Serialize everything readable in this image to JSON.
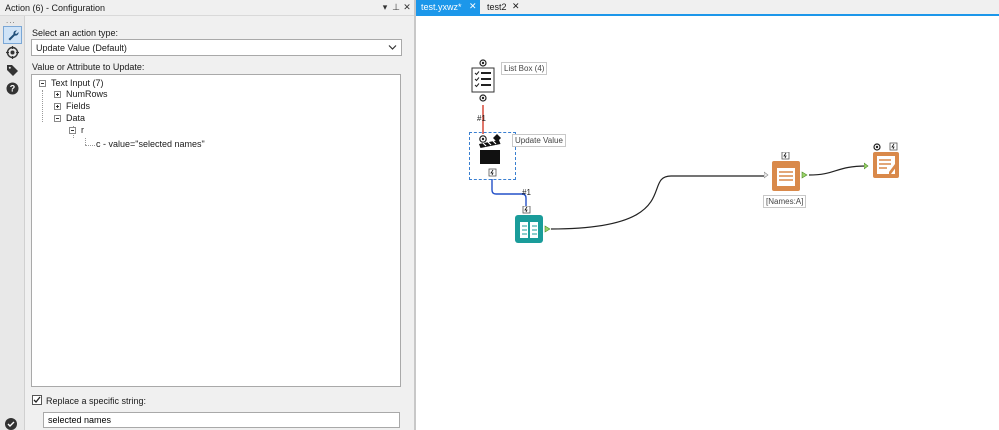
{
  "window": {
    "title": "Action (6) - Configuration",
    "ctrl_dropdown": "▾",
    "ctrl_pin": "⊥",
    "ctrl_close": "✕"
  },
  "rail": {
    "dots": "...",
    "items": [
      "wrench-icon",
      "target-icon",
      "tag-icon",
      "help-icon"
    ]
  },
  "config": {
    "action_type_label": "Select an action type:",
    "action_type_value": "Update Value (Default)",
    "attribute_label": "Value or Attribute to Update:",
    "tree": {
      "root": "Text Input (7)",
      "numrows": "NumRows",
      "fields": "Fields",
      "data": "Data",
      "r": "r",
      "c": "c - value=\"selected names\""
    },
    "replace_checked": true,
    "replace_label": "Replace a specific string:",
    "replace_value": "selected names"
  },
  "tabs": [
    {
      "label": "test.yxwz*",
      "active": true,
      "close": "✕"
    },
    {
      "label": "test2",
      "active": false,
      "close": "✕"
    }
  ],
  "canvas": {
    "tools": {
      "listbox_label": "List Box (4)",
      "update_label": "Update Value",
      "names_label": "[Names:A]"
    },
    "connections": {
      "listbox_to_update": "#1",
      "update_to_text": "#1"
    }
  },
  "colors": {
    "accent": "#1c97ea",
    "interface_orange": "#d9894a",
    "input_teal": "#1a9c9a",
    "conn_red": "#d23c2a",
    "conn_blue": "#2451c8"
  }
}
